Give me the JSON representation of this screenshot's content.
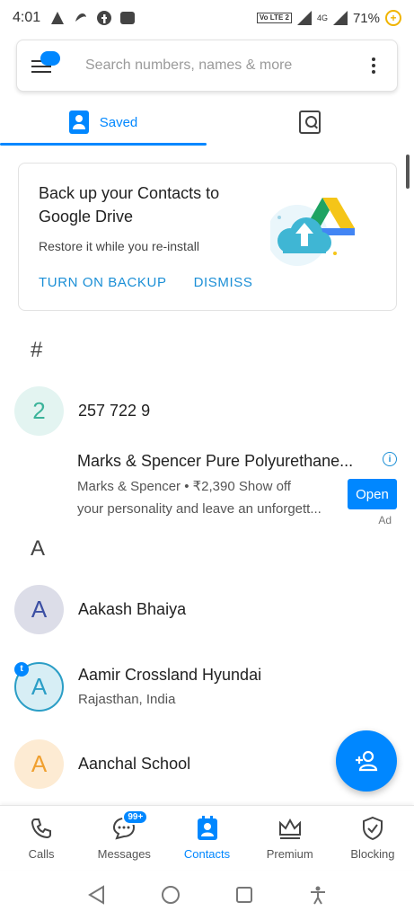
{
  "status_bar": {
    "time": "4:01",
    "battery": "71%",
    "network": "4G",
    "volte": "Vo LTE 2"
  },
  "search": {
    "placeholder": "Search numbers, names & more"
  },
  "tabs": [
    {
      "label": "Saved",
      "active": true
    },
    {
      "label": "",
      "active": false
    }
  ],
  "backup_card": {
    "title": "Back up your Contacts to Google Drive",
    "subtitle": "Restore it while you re-install",
    "primary_action": "TURN ON BACKUP",
    "secondary_action": "DISMISS"
  },
  "sections": {
    "hash": "#",
    "a": "A"
  },
  "contacts": [
    {
      "initial": "2",
      "name": "257 722 9",
      "sub": "",
      "avatar_bg": "#e3f4f1",
      "avatar_fg": "#3bb39a"
    },
    {
      "initial": "A",
      "name": "Aakash Bhaiya",
      "sub": "",
      "avatar_bg": "#dcdde8",
      "avatar_fg": "#3c4fa3"
    },
    {
      "initial": "A",
      "name": "Aamir Crossland Hyundai",
      "sub": "Rajasthan, India",
      "avatar_bg": "#d7eef5",
      "avatar_fg": "#2b9ec6"
    },
    {
      "initial": "A",
      "name": "Aanchal School",
      "sub": "",
      "avatar_bg": "#fdebd3",
      "avatar_fg": "#f0a030"
    }
  ],
  "ad": {
    "title": "Marks & Spencer Pure Polyurethane...",
    "line1": "Marks & Spencer • ₹2,390 Show off",
    "line2": "your personality and leave an unforgett...",
    "cta": "Open",
    "badge": "Ad",
    "info_icon": "i"
  },
  "bottom_nav": [
    {
      "label": "Calls",
      "icon": "phone-icon",
      "active": false
    },
    {
      "label": "Messages",
      "icon": "chat-icon",
      "active": false,
      "badge": "99+"
    },
    {
      "label": "Contacts",
      "icon": "contacts-icon",
      "active": true
    },
    {
      "label": "Premium",
      "icon": "crown-icon",
      "active": false
    },
    {
      "label": "Blocking",
      "icon": "shield-icon",
      "active": false
    }
  ],
  "colors": {
    "accent": "#0087ff",
    "action_text": "#1b8fd6"
  },
  "truecaller_badge": "t"
}
